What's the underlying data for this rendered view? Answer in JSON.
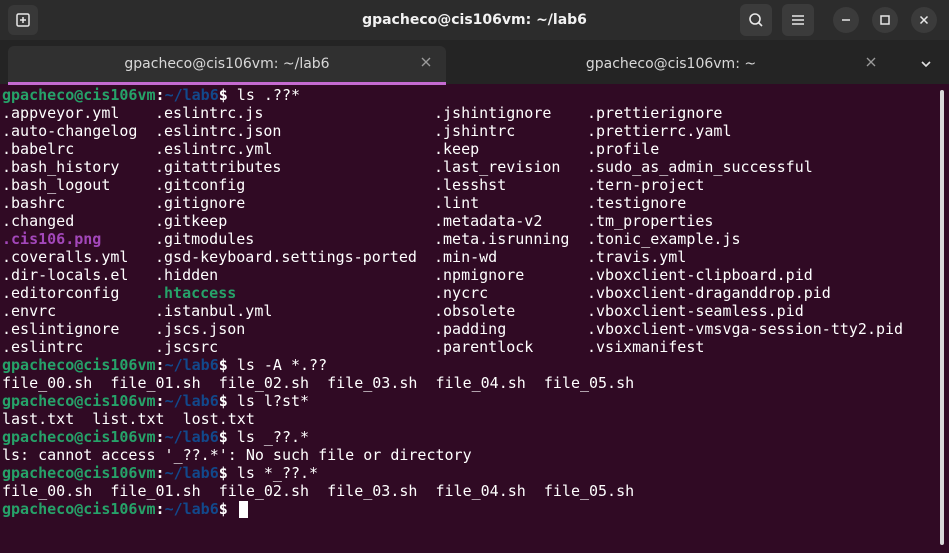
{
  "window": {
    "title": "gpacheco@cis106vm: ~/lab6",
    "accent_color": "#c56bd1",
    "background_color": "#300a24"
  },
  "titlebar": {
    "icons": [
      "new-tab-icon",
      "search-icon",
      "hamburger-menu-icon",
      "minimize-icon",
      "maximize-icon",
      "close-icon"
    ]
  },
  "tabs": [
    {
      "label": "gpacheco@cis106vm: ~/lab6",
      "active": true
    },
    {
      "label": "gpacheco@cis106vm: ~",
      "active": false
    }
  ],
  "prompt": {
    "user_host": "gpacheco@cis106vm",
    "separator": ":",
    "path": "~/lab6",
    "dollar": "$"
  },
  "commands": {
    "c1": " ls .??*",
    "c2": " ls -A *.??",
    "c3": " ls l?st*",
    "c4": " ls _??.*",
    "c5": " ls *_??.*",
    "c6": " "
  },
  "listing": {
    "col1": [
      ".appveyor.yml",
      ".auto-changelog",
      ".babelrc",
      ".bash_history",
      ".bash_logout",
      ".bashrc",
      ".changed",
      ".cis106.png",
      ".coveralls.yml",
      ".dir-locals.el",
      ".editorconfig",
      ".envrc",
      ".eslintignore",
      ".eslintrc"
    ],
    "col2": [
      ".eslintrc.js",
      ".eslintrc.json",
      ".eslintrc.yml",
      ".gitattributes",
      ".gitconfig",
      ".gitignore",
      ".gitkeep",
      ".gitmodules",
      ".gsd-keyboard.settings-ported",
      ".hidden",
      ".htaccess",
      ".istanbul.yml",
      ".jscs.json",
      ".jscsrc"
    ],
    "col3": [
      ".jshintignore",
      ".jshintrc",
      ".keep",
      ".last_revision",
      ".lesshst",
      ".lint",
      ".metadata-v2",
      ".meta.isrunning",
      ".min-wd",
      ".npmignore",
      ".nycrc",
      ".obsolete",
      ".padding",
      ".parentlock"
    ],
    "col4": [
      ".prettierignore",
      ".prettierrc.yaml",
      ".profile",
      ".sudo_as_admin_successful",
      ".tern-project",
      ".testignore",
      ".tm_properties",
      ".tonic_example.js",
      ".travis.yml",
      ".vboxclient-clipboard.pid",
      ".vboxclient-draganddrop.pid",
      ".vboxclient-seamless.pid",
      ".vboxclient-vmsvga-session-tty2.pid",
      ".vsixmanifest"
    ]
  },
  "outputs": {
    "o2": "file_00.sh  file_01.sh  file_02.sh  file_03.sh  file_04.sh  file_05.sh",
    "o3": "last.txt  list.txt  lost.txt",
    "o4": "ls: cannot access '_??.*': No such file or directory",
    "o5": "file_00.sh  file_01.sh  file_02.sh  file_03.sh  file_04.sh  file_05.sh"
  },
  "colors": {
    "prompt_user": "#26a269",
    "prompt_path": "#12488b",
    "image_file": "#a347ba",
    "executable_file": "#26a269"
  }
}
